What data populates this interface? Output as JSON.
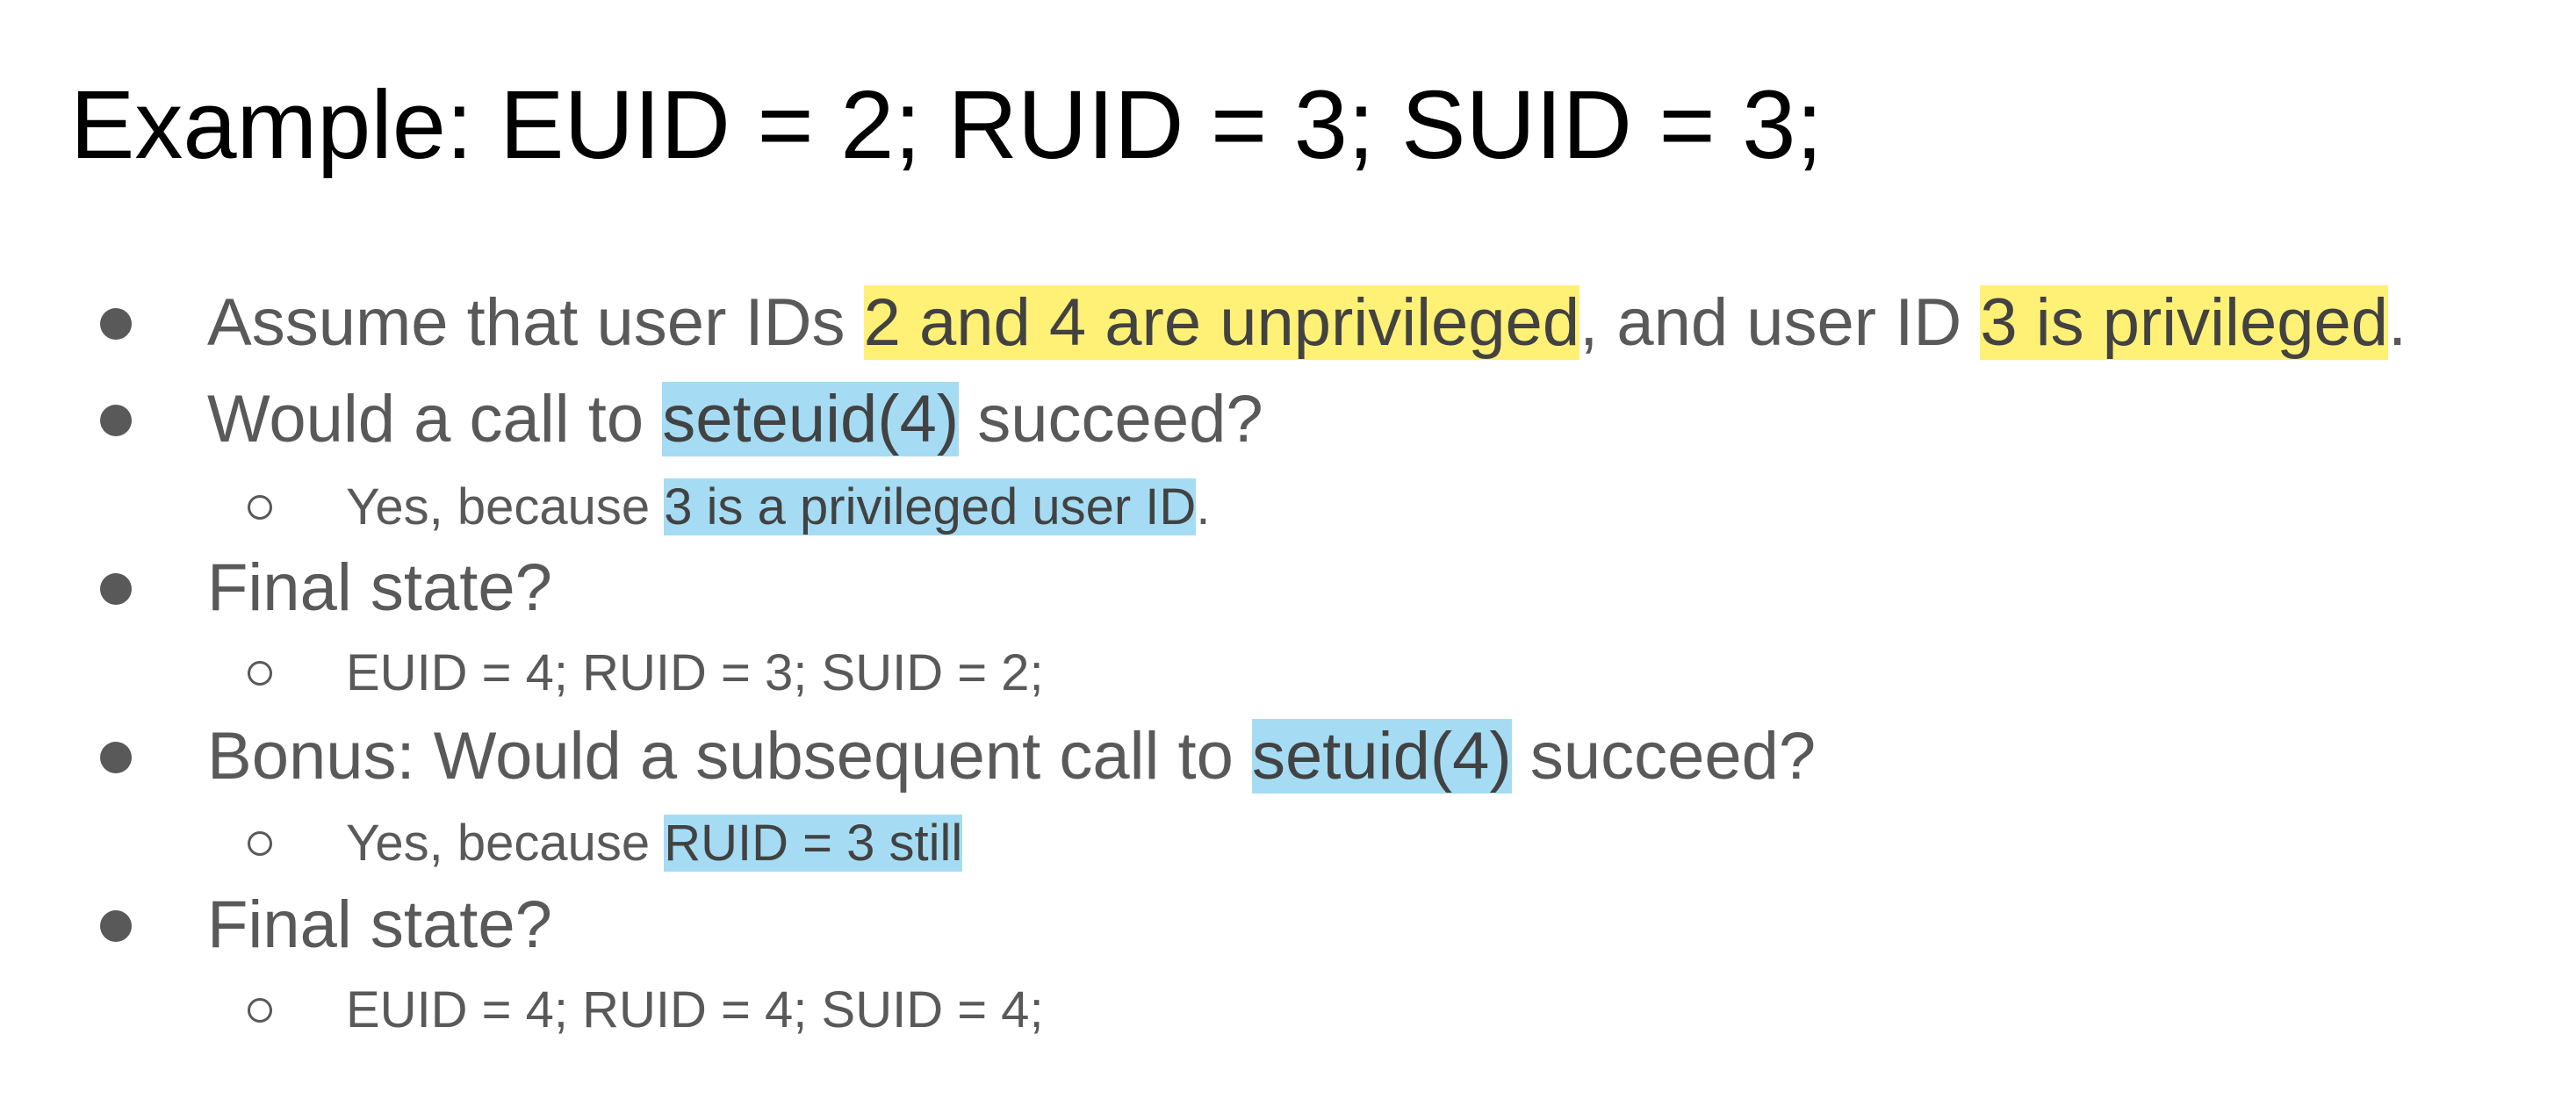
{
  "title": "Example: EUID = 2; RUID = 3; SUID = 3;",
  "bullets": [
    {
      "parts": [
        "Assume that user IDs ",
        "2 and 4 are unprivileged",
        ", and user ID ",
        "3 is privileged",
        "."
      ]
    },
    {
      "parts": [
        "Would a call to ",
        "seteuid(4)",
        " succeed?"
      ],
      "sub": {
        "parts": [
          "Yes, because ",
          "3 is a privileged user ID",
          "."
        ]
      }
    },
    {
      "parts": [
        "Final state?"
      ],
      "sub": {
        "parts": [
          "EUID = 4; RUID = 3; SUID = 2;"
        ]
      }
    },
    {
      "parts": [
        "Bonus: Would a subsequent call to ",
        "setuid(4)",
        " succeed?"
      ],
      "sub": {
        "parts": [
          "Yes, because ",
          "RUID = 3 still"
        ]
      }
    },
    {
      "parts": [
        "Final state?"
      ],
      "sub": {
        "parts": [
          "EUID = 4; RUID = 4; SUID = 4;"
        ]
      }
    }
  ],
  "colors": {
    "highlight_yellow": "#fff176",
    "highlight_blue": "#a5dcf4",
    "body_text": "#595959",
    "title_text": "#000000"
  },
  "icons": {
    "level1_bullet": "filled-circle",
    "level2_bullet": "hollow-circle"
  }
}
